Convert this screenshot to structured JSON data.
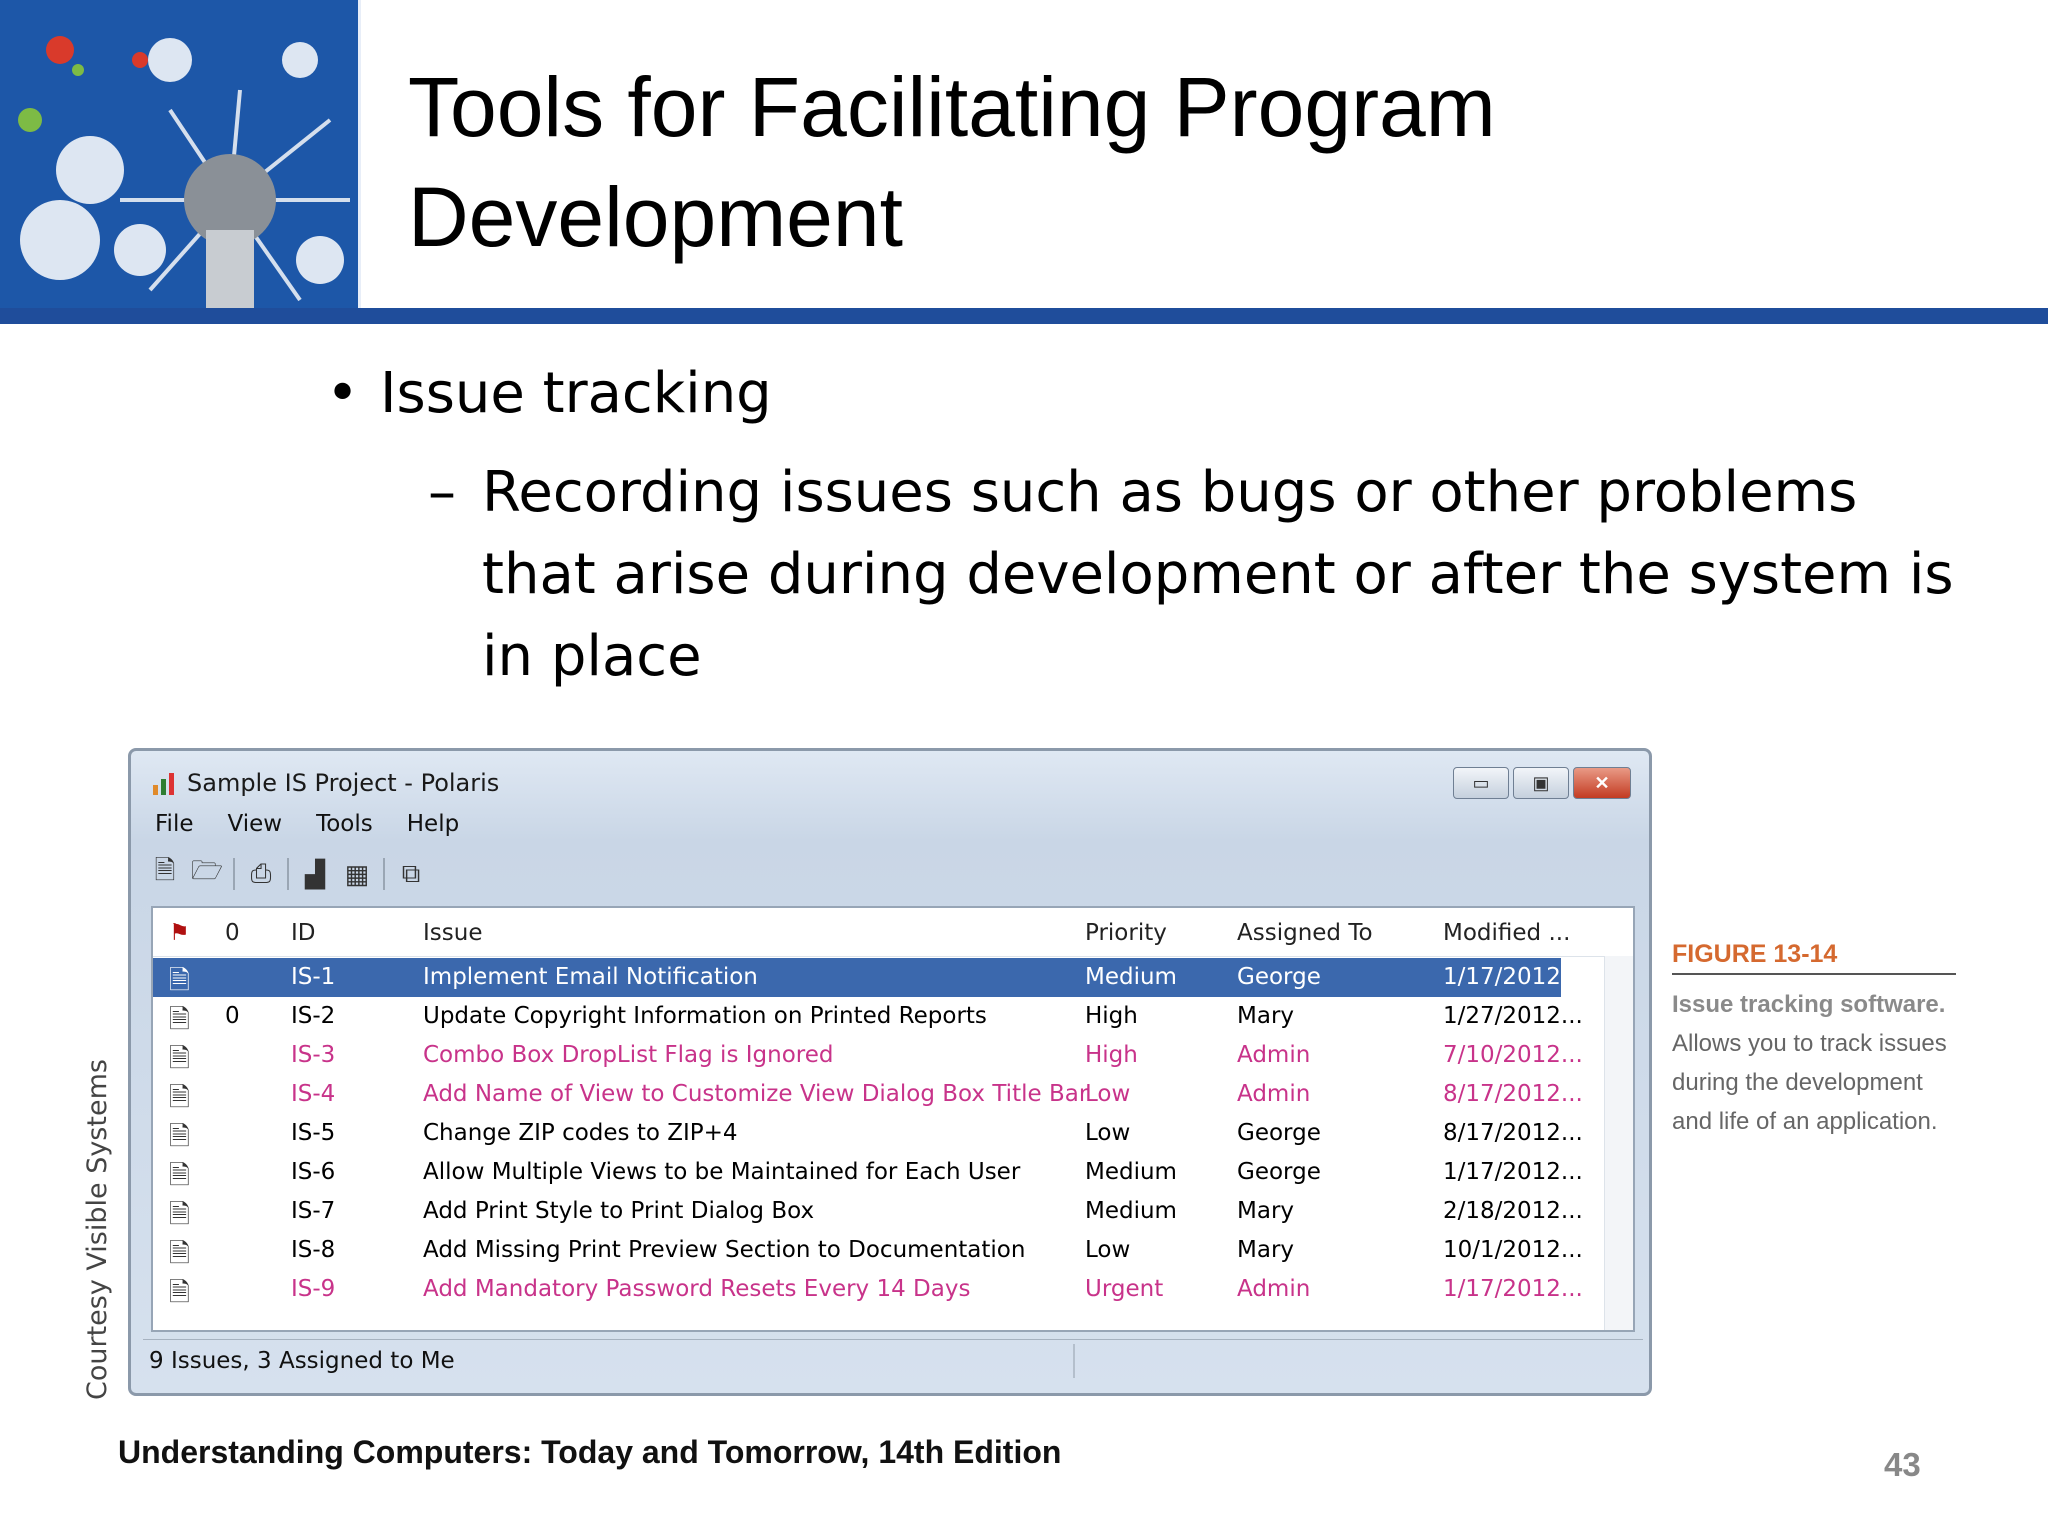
{
  "slide": {
    "title_lines": [
      "Tools for Facilitating Program",
      "Development"
    ],
    "bullet": "Issue tracking",
    "sub_bullet_dash": "–",
    "sub_bullet": "Recording issues such as bugs or other problems that arise during development or after the system is in place",
    "credit": "Courtesy Visible Systems",
    "footer": "Understanding Computers: Today and Tomorrow, 14th Edition",
    "page_number": "43"
  },
  "figure": {
    "label": "FIGURE 13-14",
    "caption_bold": "Issue tracking software.",
    "caption_rest": " Allows you to track issues during the development and life of an application."
  },
  "window": {
    "title": "Sample IS Project - Polaris",
    "menu": [
      "File",
      "View",
      "Tools",
      "Help"
    ],
    "columns": {
      "flag": "flag",
      "attach": "0",
      "id": "ID",
      "issue": "Issue",
      "priority": "Priority",
      "assigned": "Assigned To",
      "modified": "Modified ..."
    },
    "rows": [
      {
        "attach": "",
        "id": "IS-1",
        "issue": "Implement Email Notification",
        "priority": "Medium",
        "assigned": "George",
        "modified": "1/17/2012...",
        "state": "selected"
      },
      {
        "attach": "0",
        "id": "IS-2",
        "issue": "Update Copyright Information on Printed Reports",
        "priority": "High",
        "assigned": "Mary",
        "modified": "1/27/2012...",
        "state": "normal"
      },
      {
        "attach": "",
        "id": "IS-3",
        "issue": "Combo Box DropList Flag is Ignored",
        "priority": "High",
        "assigned": "Admin",
        "modified": "7/10/2012...",
        "state": "admin"
      },
      {
        "attach": "",
        "id": "IS-4",
        "issue": "Add Name of View to Customize View Dialog Box Title Bar",
        "priority": "Low",
        "assigned": "Admin",
        "modified": "8/17/2012...",
        "state": "admin"
      },
      {
        "attach": "",
        "id": "IS-5",
        "issue": "Change ZIP codes to ZIP+4",
        "priority": "Low",
        "assigned": "George",
        "modified": "8/17/2012...",
        "state": "normal"
      },
      {
        "attach": "",
        "id": "IS-6",
        "issue": "Allow Multiple Views to be Maintained for Each User",
        "priority": "Medium",
        "assigned": "George",
        "modified": "1/17/2012...",
        "state": "normal"
      },
      {
        "attach": "",
        "id": "IS-7",
        "issue": "Add Print Style to Print Dialog Box",
        "priority": "Medium",
        "assigned": "Mary",
        "modified": "2/18/2012...",
        "state": "normal"
      },
      {
        "attach": "",
        "id": "IS-8",
        "issue": "Add Missing Print Preview Section to  Documentation",
        "priority": "Low",
        "assigned": "Mary",
        "modified": "10/1/2012...",
        "state": "normal"
      },
      {
        "attach": "",
        "id": "IS-9",
        "issue": "Add Mandatory Password Resets Every 14 Days",
        "priority": "Urgent",
        "assigned": "Admin",
        "modified": "1/17/2012...",
        "state": "admin"
      }
    ],
    "status": "9 Issues, 3 Assigned to Me"
  },
  "colors": {
    "band": "#1f4d9b",
    "selection": "#3b68ad",
    "admin_text": "#c8338a",
    "figure_label": "#d5692f"
  }
}
